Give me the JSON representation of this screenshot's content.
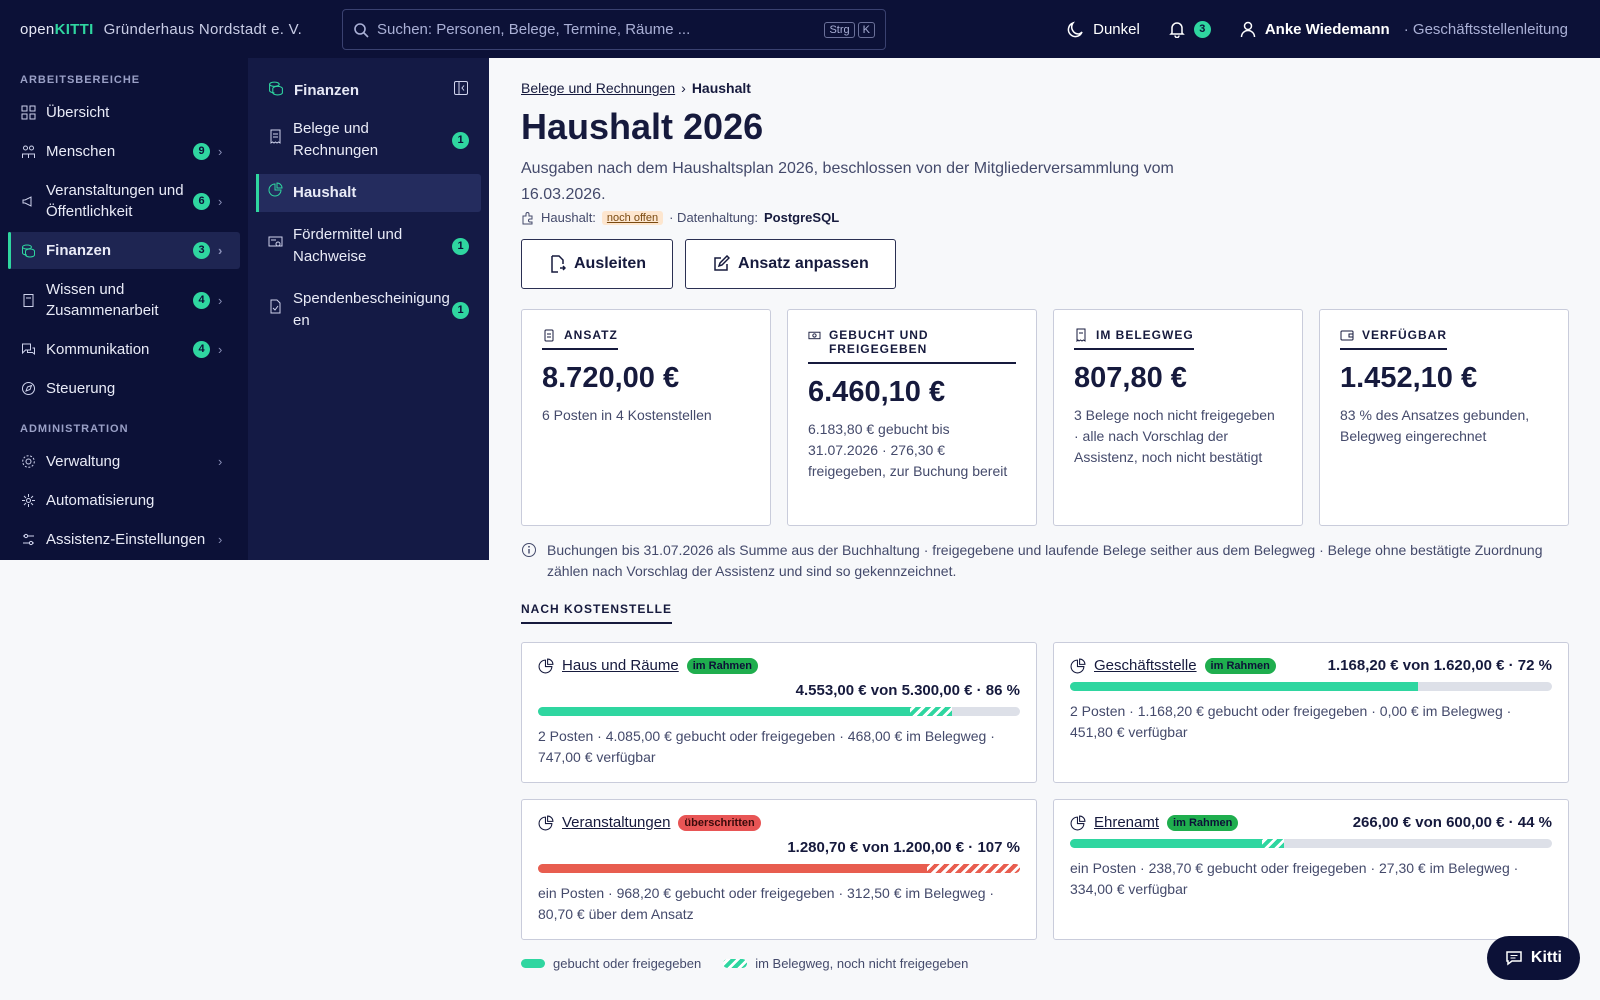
{
  "topbar": {
    "brand_pre": "open",
    "brand_accent": "KITTI",
    "org": "Gründerhaus Nordstadt e. V.",
    "search_placeholder": "Suchen: Personen, Belege, Termine, Räume ...",
    "kbd1": "Strg",
    "kbd2": "K",
    "theme_label": "Dunkel",
    "notif_count": "3",
    "user_name": "Anke Wiedemann",
    "user_role": "· Geschäftsstellenleitung"
  },
  "sidebar": {
    "sec1": "ARBEITSBEREICHE",
    "sec2": "ADMINISTRATION",
    "items": [
      {
        "label": "Übersicht",
        "count": ""
      },
      {
        "label": "Menschen",
        "count": "9"
      },
      {
        "label": "Veranstaltungen und Öffentlichkeit",
        "count": "6"
      },
      {
        "label": "Finanzen",
        "count": "3"
      },
      {
        "label": "Wissen und Zusammenarbeit",
        "count": "4"
      },
      {
        "label": "Kommunikation",
        "count": "4"
      },
      {
        "label": "Steuerung",
        "count": ""
      }
    ],
    "admin": [
      {
        "label": "Verwaltung"
      },
      {
        "label": "Automatisierung"
      },
      {
        "label": "Assistenz-Einstellungen"
      }
    ]
  },
  "subnav": {
    "title": "Finanzen",
    "items": [
      {
        "label": "Belege und Rechnungen",
        "count": "1"
      },
      {
        "label": "Haushalt",
        "count": ""
      },
      {
        "label": "Fördermittel und Nachweise",
        "count": "1"
      },
      {
        "label": "Spendenbescheinigungen",
        "count": "1"
      }
    ]
  },
  "main": {
    "crumb_parent": "Belege und Rechnungen",
    "crumb_sep": "›",
    "crumb_current": "Haushalt",
    "title": "Haushalt 2026",
    "lead": "Ausgaben nach dem Haushaltsplan 2026, beschlossen von der Mitgliederversammlung vom 16.03.2026.",
    "meta_label": "Haushalt:",
    "meta_status": "noch offen",
    "meta_store_label": "· Datenhaltung:",
    "meta_store": "PostgreSQL",
    "btn_export": "Ausleiten",
    "btn_adjust": "Ansatz anpassen",
    "kpis": [
      {
        "label": "ANSATZ",
        "value": "8.720,00 €",
        "sub": "6 Posten in 4 Kostenstellen"
      },
      {
        "label": "GEBUCHT UND FREIGEGEBEN",
        "value": "6.460,10 €",
        "sub": "6.183,80 € gebucht bis 31.07.2026 · 276,30 € freigegeben, zur Buchung bereit"
      },
      {
        "label": "IM BELEGWEG",
        "value": "807,80 €",
        "sub": "3 Belege noch nicht freigegeben · alle nach Vorschlag der Assistenz, noch nicht bestätigt"
      },
      {
        "label": "VERFÜGBAR",
        "value": "1.452,10 €",
        "sub": "83 % des Ansatzes gebunden, Belegweg eingerechnet"
      }
    ],
    "note": "Buchungen bis 31.07.2026 als Summe aus der Buchhaltung · freigegebene und laufende Belege seither aus dem Belegweg · Belege ohne bestätigte Zuordnung zählen nach Vorschlag der Assistenz und sind so gekennzeichnet.",
    "section": "NACH KOSTENSTELLE",
    "cost_centers": [
      {
        "name": "Haus und Räume",
        "tag": "im Rahmen",
        "status": "ok",
        "amount": "4.553,00 € von 5.300,00 € · 86 %",
        "booked_pct": 77.1,
        "pending_pct": 8.8,
        "sub": "2 Posten · 4.085,00 € gebucht oder freigegeben · 468,00 € im Belegweg · 747,00 € verfügbar"
      },
      {
        "name": "Geschäftsstelle",
        "tag": "im Rahmen",
        "status": "ok",
        "amount": "1.168,20 € von 1.620,00 € · 72 %",
        "booked_pct": 72.1,
        "pending_pct": 0,
        "sub": "2 Posten · 1.168,20 € gebucht oder freigegeben · 0,00 € im Belegweg · 451,80 € verfügbar"
      },
      {
        "name": "Veranstaltungen",
        "tag": "überschritten",
        "status": "over",
        "amount": "1.280,70 € von 1.200,00 € · 107 %",
        "booked_pct": 80.7,
        "pending_pct": 19.3,
        "sub": "ein Posten · 968,20 € gebucht oder freigegeben · 312,50 € im Belegweg · 80,70 € über dem Ansatz"
      },
      {
        "name": "Ehrenamt",
        "tag": "im Rahmen",
        "status": "ok",
        "amount": "266,00 € von 600,00 € · 44 %",
        "booked_pct": 39.8,
        "pending_pct": 4.6,
        "sub": "ein Posten · 238,70 € gebucht oder freigegeben · 27,30 € im Belegweg · 334,00 € verfügbar"
      }
    ],
    "legend_booked": "gebucht oder freigegeben",
    "legend_pending": "im Belegweg, noch nicht freigegeben"
  },
  "assistant_label": "Kitti",
  "colors": {
    "accent": "#2fd6a0",
    "navy": "#0c1137",
    "over": "#e85d4f"
  }
}
